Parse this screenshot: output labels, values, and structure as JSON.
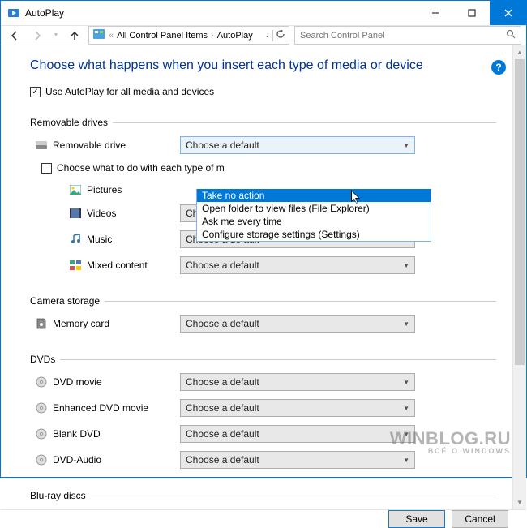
{
  "window": {
    "title": "AutoPlay"
  },
  "nav": {
    "breadcrumb_prefix": "«",
    "path": [
      "All Control Panel Items",
      "AutoPlay"
    ],
    "search_placeholder": "Search Control Panel"
  },
  "page": {
    "heading": "Choose what happens when you insert each type of media or device",
    "use_autoplay_label": "Use AutoPlay for all media and devices",
    "use_autoplay_checked": true
  },
  "sections": {
    "removable": {
      "legend": "Removable drives",
      "device": "Removable drive",
      "device_combo": "Choose a default",
      "sub_check_label": "Choose what to do with each type of m",
      "sub_check_checked": false,
      "items": [
        {
          "label": "Pictures",
          "combo": "Choose a default",
          "hidden": true
        },
        {
          "label": "Videos",
          "combo": "Choose a default"
        },
        {
          "label": "Music",
          "combo": "Choose a default"
        },
        {
          "label": "Mixed content",
          "combo": "Choose a default"
        }
      ]
    },
    "camera": {
      "legend": "Camera storage",
      "items": [
        {
          "label": "Memory card",
          "combo": "Choose a default"
        }
      ]
    },
    "dvds": {
      "legend": "DVDs",
      "items": [
        {
          "label": "DVD movie",
          "combo": "Choose a default"
        },
        {
          "label": "Enhanced DVD movie",
          "combo": "Choose a default"
        },
        {
          "label": "Blank DVD",
          "combo": "Choose a default"
        },
        {
          "label": "DVD-Audio",
          "combo": "Choose a default"
        }
      ]
    },
    "bluray": {
      "legend": "Blu-ray discs"
    }
  },
  "dropdown": {
    "options": [
      "Take no action",
      "Open folder to view files (File Explorer)",
      "Ask me every time",
      "Configure storage settings (Settings)"
    ],
    "highlighted": 0
  },
  "footer": {
    "save": "Save",
    "cancel": "Cancel"
  },
  "watermark": {
    "main": "WINBLOG.RU",
    "sub": "ВСЁ О WINDOWS"
  }
}
